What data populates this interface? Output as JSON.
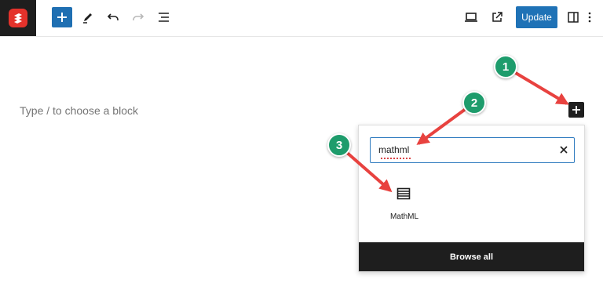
{
  "toolbar": {
    "update_label": "Update"
  },
  "editor": {
    "placeholder": "Type / to choose a block"
  },
  "inserter": {
    "search_value": "mathml",
    "results": [
      {
        "label": "MathML",
        "icon": "table-rows-icon"
      }
    ],
    "browse_all_label": "Browse all"
  },
  "annotations": {
    "badges": [
      "1",
      "2",
      "3"
    ],
    "badge_color": "#1e9c6c",
    "arrow_color": "#e8423f"
  },
  "colors": {
    "accent": "#1f72b6",
    "logo": "#e4322b",
    "dark": "#1e1e1e"
  }
}
